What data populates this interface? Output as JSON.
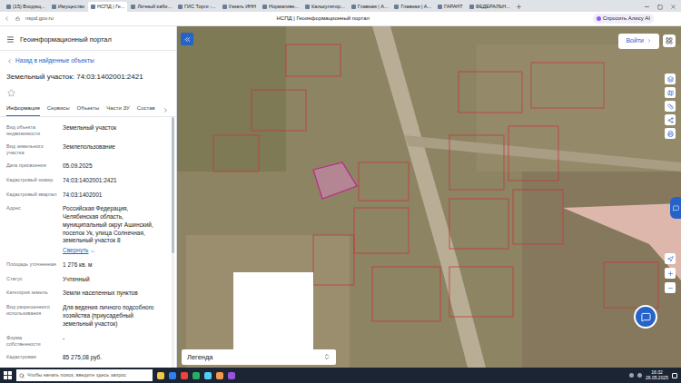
{
  "browser": {
    "tabs": [
      {
        "label": "(15) Входящ...",
        "selected": false
      },
      {
        "label": "Имущество",
        "selected": false
      },
      {
        "label": "НСПД | Ге...",
        "selected": true
      },
      {
        "label": "Личный каби...",
        "selected": false
      },
      {
        "label": "ГИС Торги -...",
        "selected": false
      },
      {
        "label": "Узнать ИНН",
        "selected": false
      },
      {
        "label": "Нормативн...",
        "selected": false
      },
      {
        "label": "Калькулятор...",
        "selected": false
      },
      {
        "label": "Главная | А...",
        "selected": false
      },
      {
        "label": "Главная | А...",
        "selected": false
      },
      {
        "label": "ГАРАНТ",
        "selected": false
      },
      {
        "label": "ФЕДЕРАЛЬН...",
        "selected": false
      }
    ],
    "address": "nspd.gov.ru",
    "page_title": "НСПД | Геоинформационный портал",
    "alice": "Спросить Алису AI"
  },
  "portal": {
    "title": "Геоинформационный портал"
  },
  "panel": {
    "back": "Назад в найденные объекты",
    "heading": "Земельный участок: 74:03:1402001:2421",
    "favorite": false,
    "tabs": [
      {
        "label": "Информация",
        "selected": true
      },
      {
        "label": "Сервисы",
        "selected": false
      },
      {
        "label": "Объекты",
        "selected": false
      },
      {
        "label": "Части ЗУ",
        "selected": false
      },
      {
        "label": "Состав",
        "selected": false
      }
    ],
    "fields": [
      {
        "label": "Вид объекта недвижимости",
        "value": "Земельный участок"
      },
      {
        "label": "Вид земельного участка",
        "value": "Землепользование"
      },
      {
        "label": "Дата присвоения",
        "value": "05.09.2025"
      },
      {
        "label": "Кадастровый номер",
        "value": "74:03:1402001:2421"
      },
      {
        "label": "Кадастровый квартал",
        "value": "74:03:1402001"
      },
      {
        "label": "Адрес",
        "value": "Российская Федерация, Челябинская область, муниципальный округ Ашинский, поселок Ук, улица Солнечная, земельный участок 8",
        "link": "Свернуть"
      },
      {
        "label": "Площадь уточненная",
        "value": "1 276 кв. м"
      },
      {
        "label": "Статус",
        "value": "Учтенный"
      },
      {
        "label": "Категория земель",
        "value": "Земли населенных пунктов"
      },
      {
        "label": "Вид разрешенного использования",
        "value": "Для ведения личного подсобного хозяйства (приусадебный земельный участок)"
      },
      {
        "label": "Форма собственности",
        "value": "-"
      },
      {
        "label": "Кадастровая",
        "value": "85 275,08 руб."
      }
    ]
  },
  "map": {
    "login": "Войти",
    "legend": "Легенда"
  },
  "taskbar": {
    "search": "Чтобы начать поиск, введите здесь запрос",
    "time": "16:32",
    "date": "26.05.2025"
  }
}
